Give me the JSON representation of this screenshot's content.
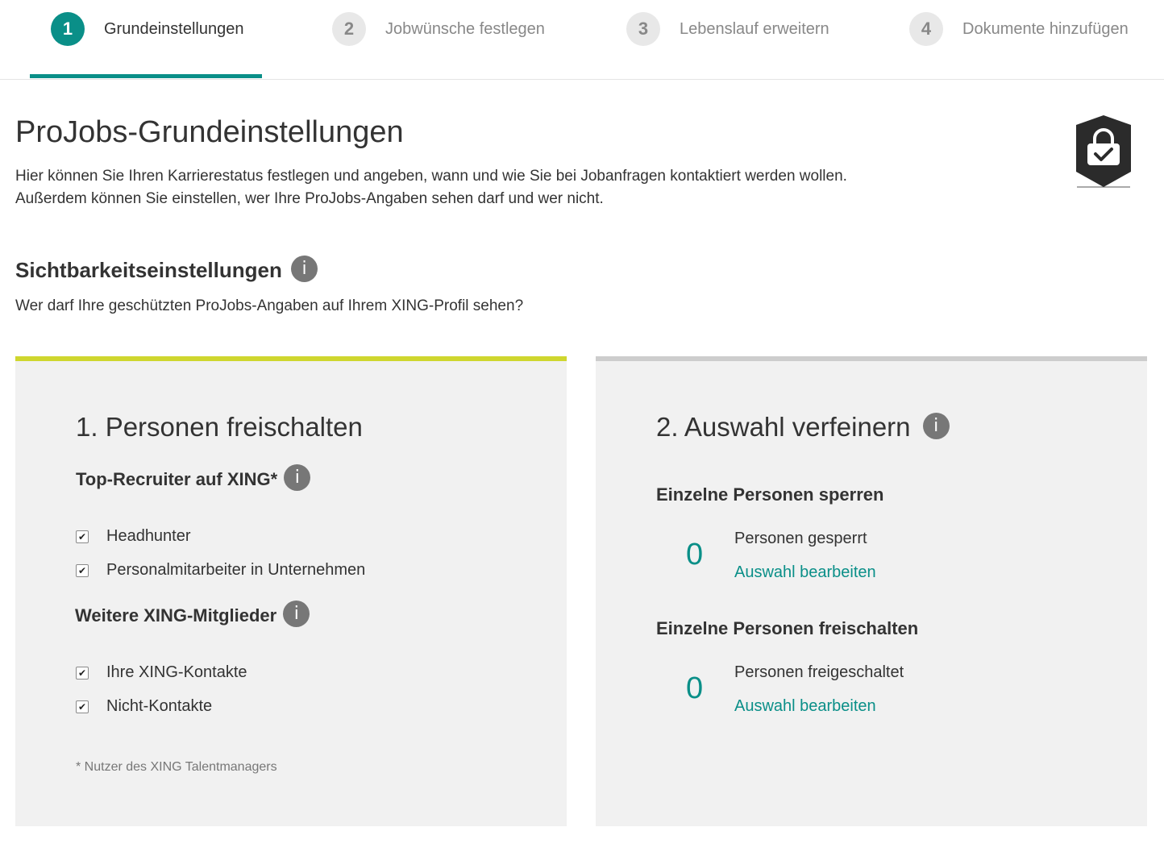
{
  "stepper": {
    "steps": [
      {
        "number": "1",
        "label": "Grundeinstellungen",
        "active": true
      },
      {
        "number": "2",
        "label": "Jobwünsche festlegen",
        "active": false
      },
      {
        "number": "3",
        "label": "Lebenslauf erweitern",
        "active": false
      },
      {
        "number": "4",
        "label": "Dokumente hinzufügen",
        "active": false
      }
    ],
    "accent_color": "#0a8f88"
  },
  "header": {
    "title": "ProJobs-Grundeinstellungen",
    "intro_line1": "Hier können Sie Ihren Karrierestatus festlegen und angeben, wann und wie Sie bei Jobanfragen kontaktiert werden wollen.",
    "intro_line2": "Außerdem können Sie einstellen, wer Ihre ProJobs-Angaben sehen darf und wer nicht.",
    "icon": "shield-lock-check-icon"
  },
  "visibility": {
    "title": "Sichtbarkeitseinstellungen",
    "info_glyph": "i",
    "description": "Wer darf Ihre geschützten ProJobs-Angaben auf Ihrem XING-Profil sehen?"
  },
  "panel_left": {
    "title": "1. Personen freischalten",
    "accent_color": "#cfd62e",
    "group1": {
      "title": "Top-Recruiter auf XING*",
      "items": [
        {
          "label": "Headhunter",
          "checked": true
        },
        {
          "label": "Personalmitarbeiter in Unternehmen",
          "checked": true
        }
      ]
    },
    "group2": {
      "title": "Weitere XING-Mitglieder",
      "items": [
        {
          "label": "Ihre XING-Kontakte",
          "checked": true
        },
        {
          "label": "Nicht-Kontakte",
          "checked": true
        }
      ]
    },
    "footnote": "* Nutzer des XING Talentmanagers"
  },
  "panel_right": {
    "title": "2. Auswahl verfeinern",
    "blocked": {
      "title": "Einzelne Personen sperren",
      "count": "0",
      "label": "Personen gesperrt",
      "link": "Auswahl bearbeiten"
    },
    "unlocked": {
      "title": "Einzelne Personen freischalten",
      "count": "0",
      "label": "Personen freigeschaltet",
      "link": "Auswahl bearbeiten"
    }
  }
}
